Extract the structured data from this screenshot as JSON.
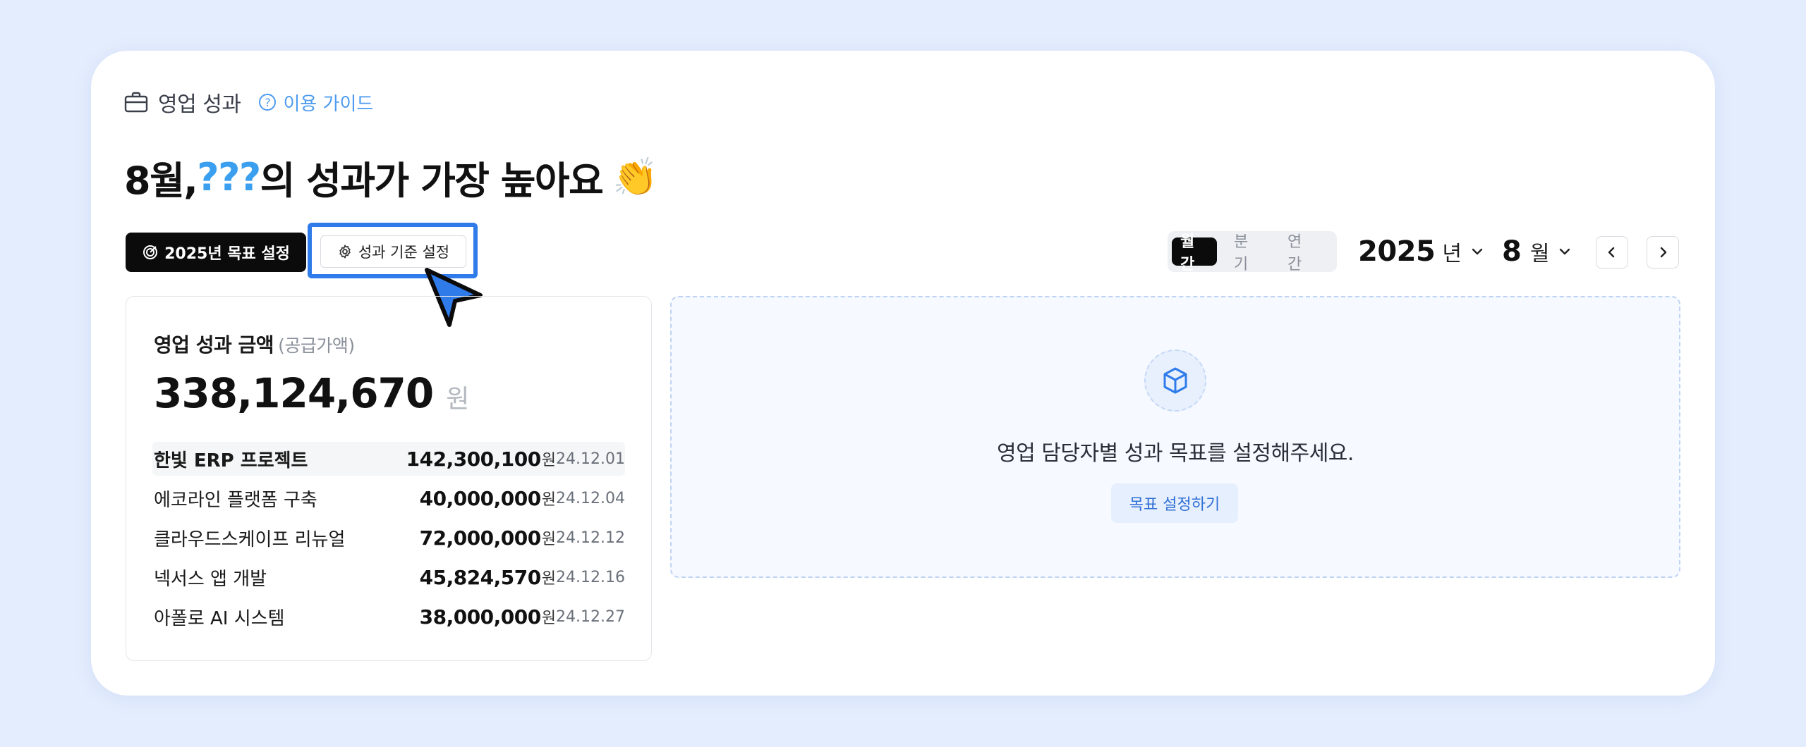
{
  "header": {
    "section_title": "영업 성과",
    "guide_label": "이용 가이드",
    "guide_icon": "help-circle-icon"
  },
  "headline": {
    "prefix": "8월, ",
    "highlight": "???",
    "suffix": "의 성과가 가장 높아요",
    "emoji": "👏"
  },
  "toolbar": {
    "goal_button_label": "2025년 목표 설정",
    "criteria_button_label": "성과 기준 설정"
  },
  "period": {
    "segments": [
      "월간",
      "분기",
      "연간"
    ],
    "selected": "월간",
    "year": "2025",
    "year_unit": "년",
    "month": "8",
    "month_unit": "월"
  },
  "sales": {
    "label": "영업 성과 금액",
    "label_sub": "(공급가액)",
    "amount": "338,124,670",
    "currency": "원",
    "deals": [
      {
        "name": "한빛 ERP 프로젝트",
        "price": "142,300,100",
        "unit": "원",
        "date": "24.12.01"
      },
      {
        "name": "에코라인 플랫폼 구축",
        "price": "40,000,000",
        "unit": "원",
        "date": "24.12.04"
      },
      {
        "name": "클라우드스케이프 리뉴얼",
        "price": "72,000,000",
        "unit": "원",
        "date": "24.12.12"
      },
      {
        "name": "넥서스 앱 개발",
        "price": "45,824,570",
        "unit": "원",
        "date": "24.12.16"
      },
      {
        "name": "아폴로 AI 시스템",
        "price": "38,000,000",
        "unit": "원",
        "date": "24.12.27"
      }
    ]
  },
  "empty_state": {
    "message": "영업 담당자별 성과 목표를 설정해주세요.",
    "button_label": "목표 설정하기"
  },
  "colors": {
    "accent": "#3b9ff0",
    "highlight_border": "#2f7bea",
    "background": "#e4edfd"
  }
}
